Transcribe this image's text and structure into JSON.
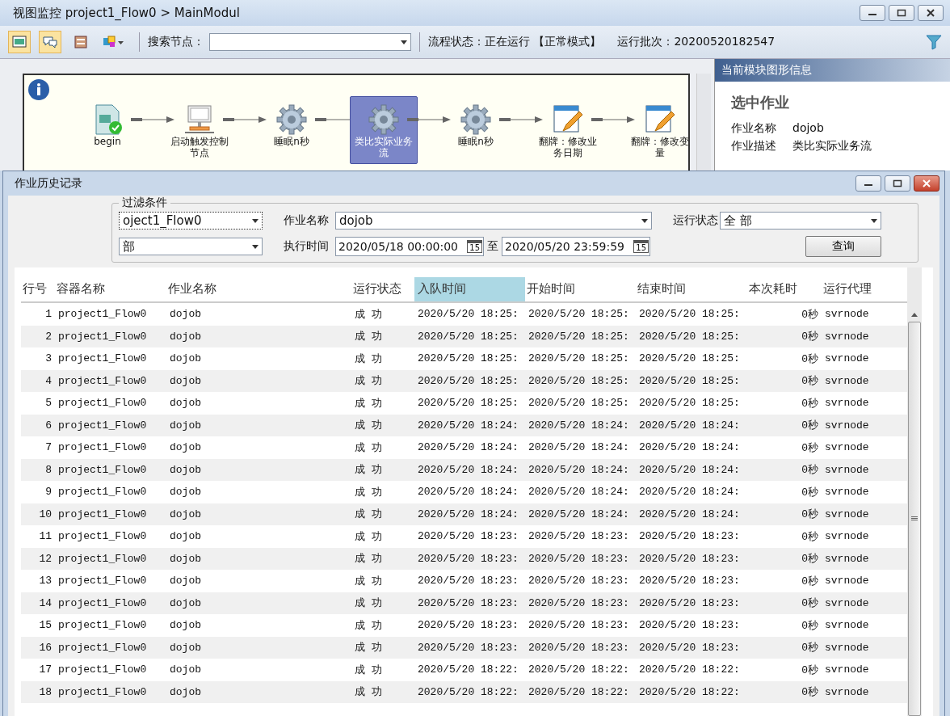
{
  "window": {
    "title": "视图监控  project1_Flow0 > MainModul"
  },
  "toolbar": {
    "tools": [
      {
        "kind": "monitor",
        "pressed": true
      },
      {
        "kind": "chat",
        "pressed": true
      },
      {
        "kind": "panel",
        "pressed": false
      },
      {
        "kind": "layout",
        "pressed": false
      }
    ],
    "search_label": "搜索节点：",
    "flow_status": "流程状态：正在运行 【正常模式】",
    "batch": "运行批次：20200520182547"
  },
  "flow": {
    "nodes": [
      {
        "kind": "begin",
        "label": "begin",
        "selected": false
      },
      {
        "kind": "computer",
        "label": "启动触发控制节点",
        "selected": false
      },
      {
        "kind": "gear",
        "label": "睡眠n秒",
        "selected": false
      },
      {
        "kind": "gear",
        "label": "类比实际业务流",
        "selected": true
      },
      {
        "kind": "gear",
        "label": "睡眠n秒",
        "selected": false
      },
      {
        "kind": "edit",
        "label": "翻牌：修改业务日期",
        "selected": false
      },
      {
        "kind": "edit",
        "label": "翻牌：修改变量",
        "selected": false
      }
    ]
  },
  "info_panel": {
    "title": "当前模块图形信息",
    "heading": "选中作业",
    "fields": [
      {
        "label": "作业名称",
        "value": "dojob"
      },
      {
        "label": "作业描述",
        "value": "类比实际业务流"
      }
    ]
  },
  "dialog": {
    "title": "作业历史记录",
    "filter": {
      "legend": "过滤条件",
      "container": "oject1_Flow0",
      "container2": "部",
      "job_label": "作业名称",
      "job": "dojob",
      "status_label": "运行状态",
      "status": "全 部",
      "time_label": "执行时间",
      "from": "2020/05/18 00:00:00",
      "to_label": "至",
      "to": "2020/05/20 23:59:59",
      "from_calendar_day": "15",
      "to_calendar_day": "15",
      "query": "查询"
    },
    "columns": [
      {
        "label": "行号",
        "selected": false
      },
      {
        "label": "容器名称",
        "selected": false
      },
      {
        "label": "作业名称",
        "selected": false
      },
      {
        "label": "运行状态",
        "selected": false
      },
      {
        "label": "入队时间",
        "selected": true
      },
      {
        "label": "开始时间",
        "selected": false
      },
      {
        "label": "结束时间",
        "selected": false
      },
      {
        "label": "本次耗时",
        "selected": false
      },
      {
        "label": "运行代理",
        "selected": false
      }
    ],
    "rows": [
      [
        "1",
        "project1_Flow0",
        "dojob",
        "成  功",
        "2020/5/20 18:25:",
        "2020/5/20 18:25:",
        "2020/5/20 18:25:",
        "0秒",
        "svrnode"
      ],
      [
        "2",
        "project1_Flow0",
        "dojob",
        "成  功",
        "2020/5/20 18:25:",
        "2020/5/20 18:25:",
        "2020/5/20 18:25:",
        "0秒",
        "svrnode"
      ],
      [
        "3",
        "project1_Flow0",
        "dojob",
        "成  功",
        "2020/5/20 18:25:",
        "2020/5/20 18:25:",
        "2020/5/20 18:25:",
        "0秒",
        "svrnode"
      ],
      [
        "4",
        "project1_Flow0",
        "dojob",
        "成  功",
        "2020/5/20 18:25:",
        "2020/5/20 18:25:",
        "2020/5/20 18:25:",
        "0秒",
        "svrnode"
      ],
      [
        "5",
        "project1_Flow0",
        "dojob",
        "成  功",
        "2020/5/20 18:25:",
        "2020/5/20 18:25:",
        "2020/5/20 18:25:",
        "0秒",
        "svrnode"
      ],
      [
        "6",
        "project1_Flow0",
        "dojob",
        "成  功",
        "2020/5/20 18:24:",
        "2020/5/20 18:24:",
        "2020/5/20 18:24:",
        "0秒",
        "svrnode"
      ],
      [
        "7",
        "project1_Flow0",
        "dojob",
        "成  功",
        "2020/5/20 18:24:",
        "2020/5/20 18:24:",
        "2020/5/20 18:24:",
        "0秒",
        "svrnode"
      ],
      [
        "8",
        "project1_Flow0",
        "dojob",
        "成  功",
        "2020/5/20 18:24:",
        "2020/5/20 18:24:",
        "2020/5/20 18:24:",
        "0秒",
        "svrnode"
      ],
      [
        "9",
        "project1_Flow0",
        "dojob",
        "成  功",
        "2020/5/20 18:24:",
        "2020/5/20 18:24:",
        "2020/5/20 18:24:",
        "0秒",
        "svrnode"
      ],
      [
        "10",
        "project1_Flow0",
        "dojob",
        "成  功",
        "2020/5/20 18:24:",
        "2020/5/20 18:24:",
        "2020/5/20 18:24:",
        "0秒",
        "svrnode"
      ],
      [
        "11",
        "project1_Flow0",
        "dojob",
        "成  功",
        "2020/5/20 18:23:",
        "2020/5/20 18:23:",
        "2020/5/20 18:23:",
        "0秒",
        "svrnode"
      ],
      [
        "12",
        "project1_Flow0",
        "dojob",
        "成  功",
        "2020/5/20 18:23:",
        "2020/5/20 18:23:",
        "2020/5/20 18:23:",
        "0秒",
        "svrnode"
      ],
      [
        "13",
        "project1_Flow0",
        "dojob",
        "成  功",
        "2020/5/20 18:23:",
        "2020/5/20 18:23:",
        "2020/5/20 18:23:",
        "0秒",
        "svrnode"
      ],
      [
        "14",
        "project1_Flow0",
        "dojob",
        "成  功",
        "2020/5/20 18:23:",
        "2020/5/20 18:23:",
        "2020/5/20 18:23:",
        "0秒",
        "svrnode"
      ],
      [
        "15",
        "project1_Flow0",
        "dojob",
        "成  功",
        "2020/5/20 18:23:",
        "2020/5/20 18:23:",
        "2020/5/20 18:23:",
        "0秒",
        "svrnode"
      ],
      [
        "16",
        "project1_Flow0",
        "dojob",
        "成  功",
        "2020/5/20 18:23:",
        "2020/5/20 18:23:",
        "2020/5/20 18:23:",
        "0秒",
        "svrnode"
      ],
      [
        "17",
        "project1_Flow0",
        "dojob",
        "成  功",
        "2020/5/20 18:22:",
        "2020/5/20 18:22:",
        "2020/5/20 18:22:",
        "0秒",
        "svrnode"
      ],
      [
        "18",
        "project1_Flow0",
        "dojob",
        "成  功",
        "2020/5/20 18:22:",
        "2020/5/20 18:22:",
        "2020/5/20 18:22:",
        "0秒",
        "svrnode"
      ]
    ]
  }
}
